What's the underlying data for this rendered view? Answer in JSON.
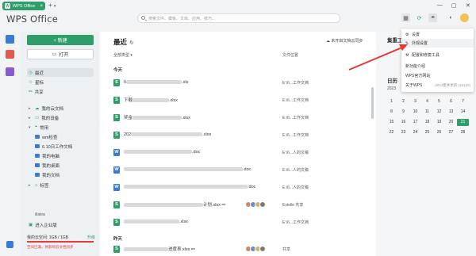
{
  "titlebar": {
    "tab_label": "WPS Office",
    "logo_char": "W",
    "add_tab": "+",
    "brand": "WPS Office",
    "search_placeholder": "搜索文件、模板、文库、应用、技巧..."
  },
  "sidebar": {
    "new_button": "+  新建",
    "open_button": "打开",
    "nav": {
      "recent": "最近",
      "starred": "星标",
      "shared": "共享",
      "cloud_docs": "我的云文档",
      "my_devices": "我的设备",
      "common": "常用",
      "folder1": "wm检查",
      "folder2": "6.10日工作文档",
      "pc": "我的电脑",
      "desktop": "我的桌面",
      "documents": "我的文档",
      "tags": "标签"
    },
    "user_name": "illalea",
    "team": "进入企业版",
    "storage_label": "我的云空间: 1GB / 1GB",
    "upgrade": "升级",
    "warning": "空间已满，将影响云文档同步"
  },
  "main": {
    "title": "最近",
    "sync": "未开启文档云同步",
    "col_type": "全部类型",
    "col_location": "文件位置",
    "group_today": "今天",
    "group_yesterday": "昨天",
    "files": [
      {
        "prefix": "6",
        "suffix": ".xls",
        "loc": "E:\\6...工作文档"
      },
      {
        "prefix": "下载",
        "suffix": ".xlsx",
        "loc": "E:\\6...工作文档"
      },
      {
        "prefix": "奖金",
        "suffix": ".xlsx",
        "loc": "E:\\6...工作文档"
      },
      {
        "prefix": "202",
        "suffix": ".xlsx",
        "loc": "E:\\6...工作文档"
      },
      {
        "prefix": "",
        "suffix": ".doc",
        "loc": "E:\\6...人的文稿"
      },
      {
        "prefix": "",
        "suffix": ".doc",
        "loc": "E:\\6...人的文稿"
      },
      {
        "prefix": "",
        "suffix": ".doc",
        "loc": "E:\\6...人的文稿"
      },
      {
        "prefix": "",
        "suffix": "计划.xlsx",
        "loc": "Estelle  共享"
      },
      {
        "prefix": "",
        "suffix": ".xlsx",
        "loc": "E:\\6...工作文档"
      },
      {
        "prefix": "",
        "suffix": "进度表.xlsx",
        "loc": "共享"
      }
    ]
  },
  "rpanel": {
    "title": "集重工",
    "heading": "日历",
    "year": "2023"
  },
  "calendar": {
    "days": [
      "1",
      "2",
      "3",
      "4",
      "5",
      "6",
      "7",
      "8",
      "9",
      "10",
      "11",
      "12",
      "13",
      "14",
      "15",
      "16",
      "17",
      "18",
      "19",
      "20",
      "21",
      "22",
      "23",
      "24",
      "25",
      "26",
      "27",
      "28"
    ],
    "today": "21"
  },
  "menu": {
    "items": [
      "设置",
      "外观设置",
      "配置和修复工具",
      "新功能介绍",
      "WPS官方网站",
      "关于WPS"
    ],
    "version": "2023夏季更新 (15120)"
  },
  "colors": {
    "accent": "#2f9e6a",
    "word": "#3a7bd5",
    "warning": "#e23c3c",
    "arrow": "#e53935"
  }
}
